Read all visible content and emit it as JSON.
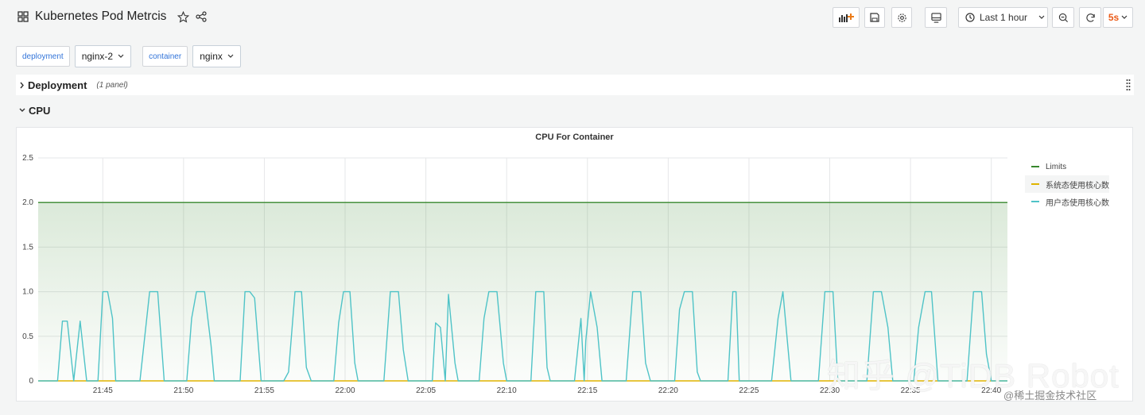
{
  "header": {
    "title": "Kubernetes Pod Metrcis",
    "time_range": "Last 1 hour",
    "refresh": "5s"
  },
  "variables": [
    {
      "label": "deployment",
      "value": "nginx-2"
    },
    {
      "label": "container",
      "value": "nginx"
    }
  ],
  "rows": {
    "deployment": {
      "title": "Deployment",
      "meta": "(1 panel)"
    },
    "cpu": {
      "title": "CPU"
    }
  },
  "watermark": {
    "main": "知乎 @TiDB Robot",
    "sub": "@稀土掘金技术社区"
  },
  "chart_data": {
    "type": "line",
    "title": "CPU For Container",
    "ylim": [
      0,
      2.5
    ],
    "yticks": [
      "0",
      "0.5",
      "1.0",
      "1.5",
      "2.0",
      "2.5"
    ],
    "xticks": [
      "21:45",
      "21:50",
      "21:55",
      "22:00",
      "22:05",
      "22:10",
      "22:15",
      "22:20",
      "22:25",
      "22:30",
      "22:35",
      "22:40"
    ],
    "xrange_minutes": [
      -4,
      56
    ],
    "grid": true,
    "legend_position": "right",
    "series": [
      {
        "name": "Limits",
        "color": "#37872d",
        "fill": true,
        "points": [
          [
            -4,
            2.0
          ],
          [
            56,
            2.0
          ]
        ]
      },
      {
        "name": "系统态使用核心数",
        "color": "#e0b400",
        "points": [
          [
            -4,
            0
          ],
          [
            56,
            0
          ]
        ]
      },
      {
        "name": "用户态使用核心数",
        "color": "#4fc3c7",
        "points": [
          [
            -4,
            0
          ],
          [
            -2.8,
            0
          ],
          [
            -2.5,
            0.67
          ],
          [
            -2.2,
            0.67
          ],
          [
            -1.8,
            0
          ],
          [
            -1.4,
            0.67
          ],
          [
            -1.0,
            0
          ],
          [
            -0.3,
            0
          ],
          [
            0,
            1.0
          ],
          [
            0.3,
            1.0
          ],
          [
            0.6,
            0.7
          ],
          [
            0.8,
            0
          ],
          [
            2.3,
            0
          ],
          [
            2.9,
            1.0
          ],
          [
            3.4,
            1.0
          ],
          [
            3.8,
            0
          ],
          [
            5.2,
            0
          ],
          [
            5.5,
            0.7
          ],
          [
            5.8,
            1.0
          ],
          [
            6.3,
            1.0
          ],
          [
            6.7,
            0.4
          ],
          [
            6.9,
            0
          ],
          [
            8.5,
            0
          ],
          [
            8.8,
            1.0
          ],
          [
            9.1,
            1.0
          ],
          [
            9.4,
            0.93
          ],
          [
            9.8,
            0
          ],
          [
            11.2,
            0
          ],
          [
            11.5,
            0.1
          ],
          [
            11.9,
            1.0
          ],
          [
            12.3,
            1.0
          ],
          [
            12.6,
            0.15
          ],
          [
            12.9,
            0
          ],
          [
            14.3,
            0
          ],
          [
            14.6,
            0.65
          ],
          [
            14.9,
            1.0
          ],
          [
            15.3,
            1.0
          ],
          [
            15.6,
            0.2
          ],
          [
            15.8,
            0
          ],
          [
            17.4,
            0
          ],
          [
            17.8,
            1.0
          ],
          [
            18.3,
            1.0
          ],
          [
            18.6,
            0.35
          ],
          [
            18.9,
            0
          ],
          [
            20.4,
            0
          ],
          [
            20.6,
            0.65
          ],
          [
            20.9,
            0.6
          ],
          [
            21.2,
            0
          ],
          [
            21.4,
            0.97
          ],
          [
            21.8,
            0.2
          ],
          [
            22.0,
            0
          ],
          [
            23.3,
            0
          ],
          [
            23.6,
            0.7
          ],
          [
            23.9,
            1.0
          ],
          [
            24.4,
            1.0
          ],
          [
            24.8,
            0.2
          ],
          [
            25.0,
            0
          ],
          [
            26.5,
            0
          ],
          [
            26.8,
            1.0
          ],
          [
            27.3,
            1.0
          ],
          [
            27.5,
            0.15
          ],
          [
            27.7,
            0
          ],
          [
            29.2,
            0
          ],
          [
            29.6,
            0.7
          ],
          [
            29.8,
            0
          ],
          [
            29.9,
            0.45
          ],
          [
            30.2,
            1.0
          ],
          [
            30.6,
            0.6
          ],
          [
            30.9,
            0
          ],
          [
            32.4,
            0
          ],
          [
            32.8,
            1.0
          ],
          [
            33.3,
            1.0
          ],
          [
            33.6,
            0.2
          ],
          [
            33.9,
            0
          ],
          [
            35.4,
            0
          ],
          [
            35.7,
            0.8
          ],
          [
            36.0,
            1.0
          ],
          [
            36.5,
            1.0
          ],
          [
            36.8,
            0.1
          ],
          [
            37.0,
            0
          ],
          [
            38.7,
            0
          ],
          [
            39.0,
            1.0
          ],
          [
            39.2,
            1.0
          ],
          [
            39.4,
            0
          ],
          [
            41.4,
            0
          ],
          [
            41.8,
            0.7
          ],
          [
            42.1,
            1.0
          ],
          [
            42.4,
            0.4
          ],
          [
            42.6,
            0
          ],
          [
            44.3,
            0
          ],
          [
            44.7,
            1.0
          ],
          [
            45.2,
            1.0
          ],
          [
            45.5,
            0
          ],
          [
            47.3,
            0
          ],
          [
            47.7,
            1.0
          ],
          [
            48.2,
            1.0
          ],
          [
            48.6,
            0.6
          ],
          [
            48.9,
            0
          ],
          [
            50.2,
            0
          ],
          [
            50.5,
            0.6
          ],
          [
            50.9,
            1.0
          ],
          [
            51.3,
            1.0
          ],
          [
            51.7,
            0
          ],
          [
            53.5,
            0
          ],
          [
            53.9,
            1.0
          ],
          [
            54.4,
            1.0
          ],
          [
            54.7,
            0.3
          ],
          [
            55.0,
            0
          ],
          [
            56,
            0
          ]
        ]
      }
    ]
  }
}
